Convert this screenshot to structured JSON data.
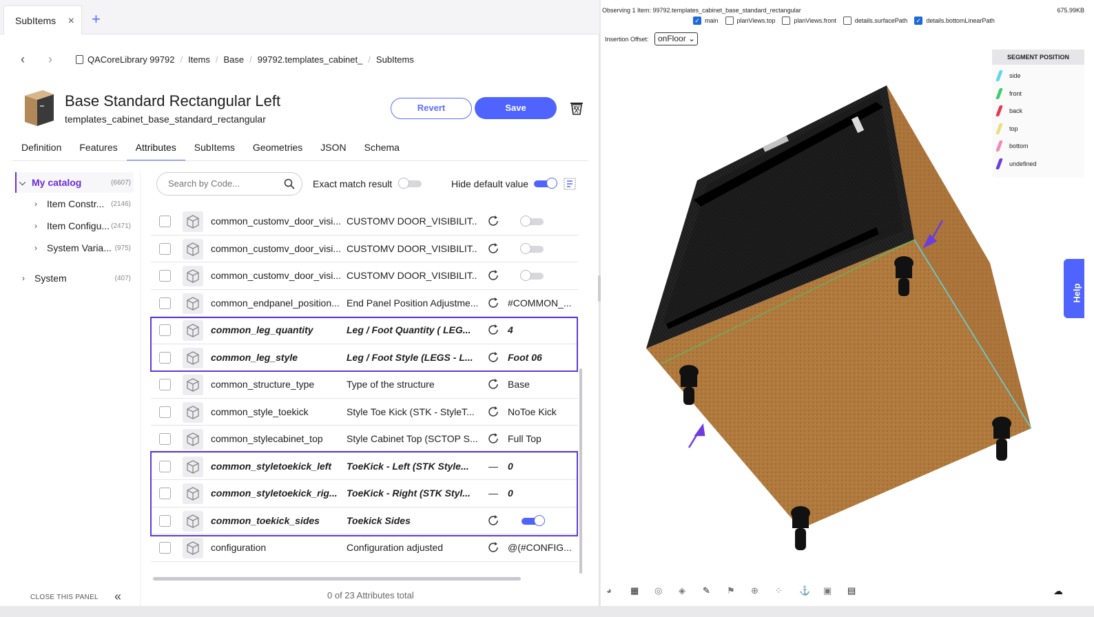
{
  "tab": {
    "label": "SubItems"
  },
  "breadcrumb": [
    "QACoreLibrary 99792",
    "Items",
    "Base",
    "99792.templates_cabinet_",
    "SubItems"
  ],
  "header": {
    "title": "Base Standard Rectangular Left",
    "subtitle": "templates_cabinet_base_standard_rectangular",
    "revert": "Revert",
    "save": "Save"
  },
  "nav_tabs": [
    "Definition",
    "Features",
    "Attributes",
    "SubItems",
    "Geometries",
    "JSON",
    "Schema"
  ],
  "active_tab": "Attributes",
  "tree": {
    "my_catalog": {
      "label": "My catalog",
      "count": "(6607)"
    },
    "children": [
      {
        "label": "Item Constr...",
        "count": "(2146)"
      },
      {
        "label": "Item Configu...",
        "count": "(2471)"
      },
      {
        "label": "System Varia...",
        "count": "(975)"
      }
    ],
    "system": {
      "label": "System",
      "count": "(407)"
    }
  },
  "close_panel": "CLOSE THIS PANEL",
  "search": {
    "placeholder": "Search by Code..."
  },
  "exact_match": {
    "label": "Exact match result",
    "on": false
  },
  "hide_default": {
    "label": "Hide default value",
    "on": true
  },
  "rows": [
    {
      "code": "common_customv_door_visi...",
      "desc": "CUSTOMV DOOR_VISIBILIT...",
      "value": "",
      "toggle": false,
      "bold": false
    },
    {
      "code": "common_customv_door_visi...",
      "desc": "CUSTOMV DOOR_VISIBILIT...",
      "value": "",
      "toggle": false,
      "bold": false
    },
    {
      "code": "common_customv_door_visi...",
      "desc": "CUSTOMV DOOR_VISIBILIT...",
      "value": "",
      "toggle": false,
      "bold": false
    },
    {
      "code": "common_endpanel_position...",
      "desc": "End Panel Position Adjustme...",
      "value": "#COMMON_...",
      "bold": false
    },
    {
      "code": "common_leg_quantity",
      "desc": "Leg / Foot Quantity ( LEG...",
      "value": "4",
      "bold": true
    },
    {
      "code": "common_leg_style",
      "desc": "Leg / Foot Style (LEGS - L...",
      "value": "Foot 06",
      "bold": true
    },
    {
      "code": "common_structure_type",
      "desc": "Type of the structure",
      "value": "Base",
      "bold": false
    },
    {
      "code": "common_style_toekick",
      "desc": "Style Toe Kick (STK - StyleT...",
      "value": "NoToe Kick",
      "bold": false
    },
    {
      "code": "common_stylecabinet_top",
      "desc": "Style Cabinet Top (SCTOP S...",
      "value": "Full Top",
      "bold": false
    },
    {
      "code": "common_styletoekick_left",
      "desc": "ToeKick - Left (STK Style...",
      "value": "0",
      "dash": "—",
      "bold": true
    },
    {
      "code": "common_styletoekick_rig...",
      "desc": "ToeKick - Right (STK Styl...",
      "value": "0",
      "dash": "—",
      "bold": true
    },
    {
      "code": "common_toekick_sides",
      "desc": "Toekick Sides",
      "value": "",
      "toggle": true,
      "bold": true
    },
    {
      "code": "configuration",
      "desc": "Configuration adjusted",
      "value": "@(#CONFIG...",
      "bold": false
    }
  ],
  "total": "0 of 23 Attributes total",
  "viewer": {
    "observing": "Observing 1 Item: 99792.templates_cabinet_base_standard_rectangular",
    "filesize": "675.99KB",
    "layers": [
      {
        "label": "main",
        "checked": true
      },
      {
        "label": "planViews.top",
        "checked": false
      },
      {
        "label": "planViews.front",
        "checked": false
      },
      {
        "label": "details.surfacePath",
        "checked": false
      },
      {
        "label": "details.bottomLinearPath",
        "checked": true
      }
    ],
    "insertion_label": "Insertion Offset:",
    "insertion_value": "onFloor",
    "legend_title": "SEGMENT POSITION",
    "legend": [
      {
        "label": "side",
        "color": "#5fd6e6"
      },
      {
        "label": "front",
        "color": "#3ccf6e"
      },
      {
        "label": "back",
        "color": "#e23a4e"
      },
      {
        "label": "top",
        "color": "#e8e07a"
      },
      {
        "label": "bottom",
        "color": "#f08ab8"
      },
      {
        "label": "undefined",
        "color": "#6c3ce0"
      }
    ],
    "help": "Help"
  }
}
